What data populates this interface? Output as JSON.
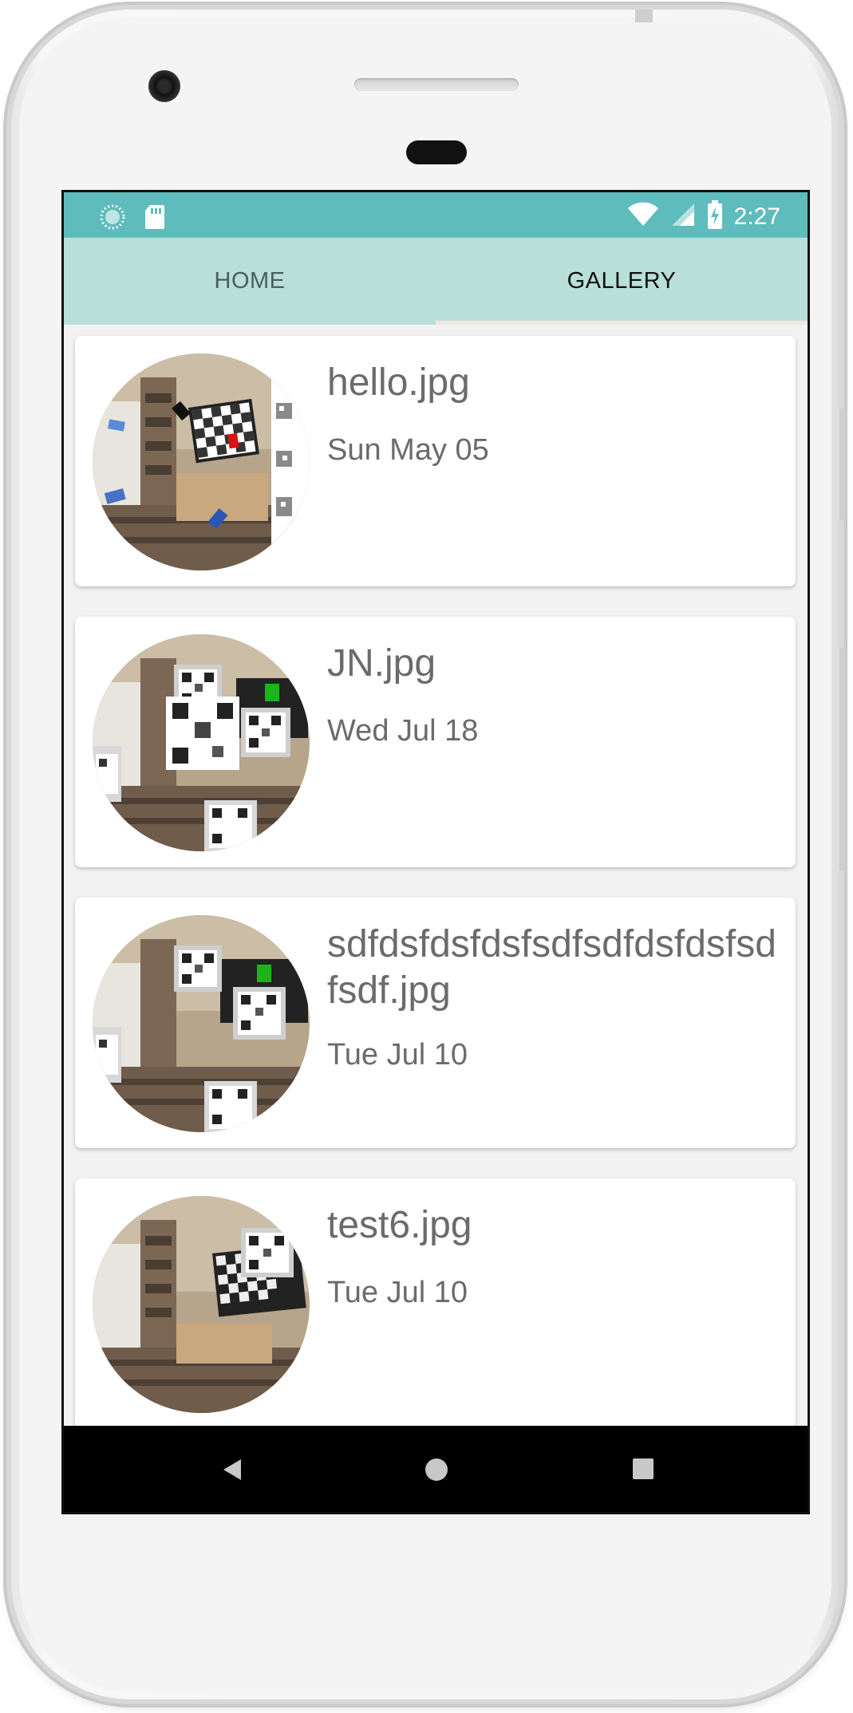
{
  "status_bar": {
    "time": "2:27",
    "icons": [
      "data-saver-icon",
      "sd-card-icon",
      "wifi-icon",
      "signal-icon",
      "battery-charging-icon"
    ]
  },
  "tabs": [
    {
      "label": "HOME",
      "selected": false
    },
    {
      "label": "GALLERY",
      "selected": true
    }
  ],
  "gallery": {
    "items": [
      {
        "name": "hello.jpg",
        "date": "Sun May 05",
        "thumbnail": "room-checkerboard-red-marker"
      },
      {
        "name": "JN.jpg",
        "date": "Wed Jul 18",
        "thumbnail": "room-qr-codes-green-marker"
      },
      {
        "name": "sdfdsfdsfdsfsdfsdfdsfdsfsdfsdf.jpg",
        "date": "Tue Jul 10",
        "thumbnail": "room-qr-codes-green-marker"
      },
      {
        "name": "test6.jpg",
        "date": "Tue Jul 10",
        "thumbnail": "room-checkerboard-qr"
      }
    ]
  },
  "nav_bar": {
    "buttons": [
      "back-icon",
      "home-icon",
      "recents-icon"
    ]
  },
  "colors": {
    "status_bar": "#5fbcbc",
    "tab_bar": "#b8e0d8",
    "text_gray": "#6b6b6b"
  }
}
